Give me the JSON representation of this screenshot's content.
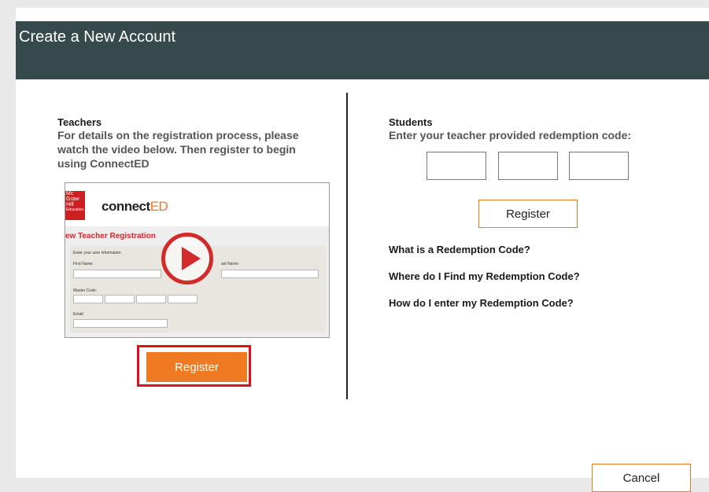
{
  "dialog": {
    "title": "Create a New Account"
  },
  "teachers": {
    "heading": "Teachers",
    "description_lines": [
      "For details on the registration process, please",
      "watch the video below. Then register to begin",
      "using ConnectED"
    ],
    "video": {
      "logo_lines": [
        "Mc",
        "Graw",
        "Hill",
        "Education"
      ],
      "brand": "connect",
      "brand_suffix": "ED",
      "registration_title": "ew Teacher Registration",
      "form_intro": "Enter your user information:",
      "first_name_label": "First Name:",
      "last_name_label": "ast Name:",
      "master_code_label": "Master Code:",
      "email_label": "Email:"
    },
    "register_label": "Register"
  },
  "students": {
    "heading": "Students",
    "instruction": "Enter your teacher provided redemption code:",
    "code_fields": [
      "",
      "",
      ""
    ],
    "register_label": "Register",
    "links": [
      "What is a Redemption Code?",
      "Where do I Find my Redemption Code?",
      "How do I enter my Redemption Code?"
    ]
  },
  "footer": {
    "cancel_label": "Cancel"
  },
  "colors": {
    "header_bg": "#364a4b",
    "accent_orange": "#f07a22",
    "highlight_red": "#e0101a"
  }
}
